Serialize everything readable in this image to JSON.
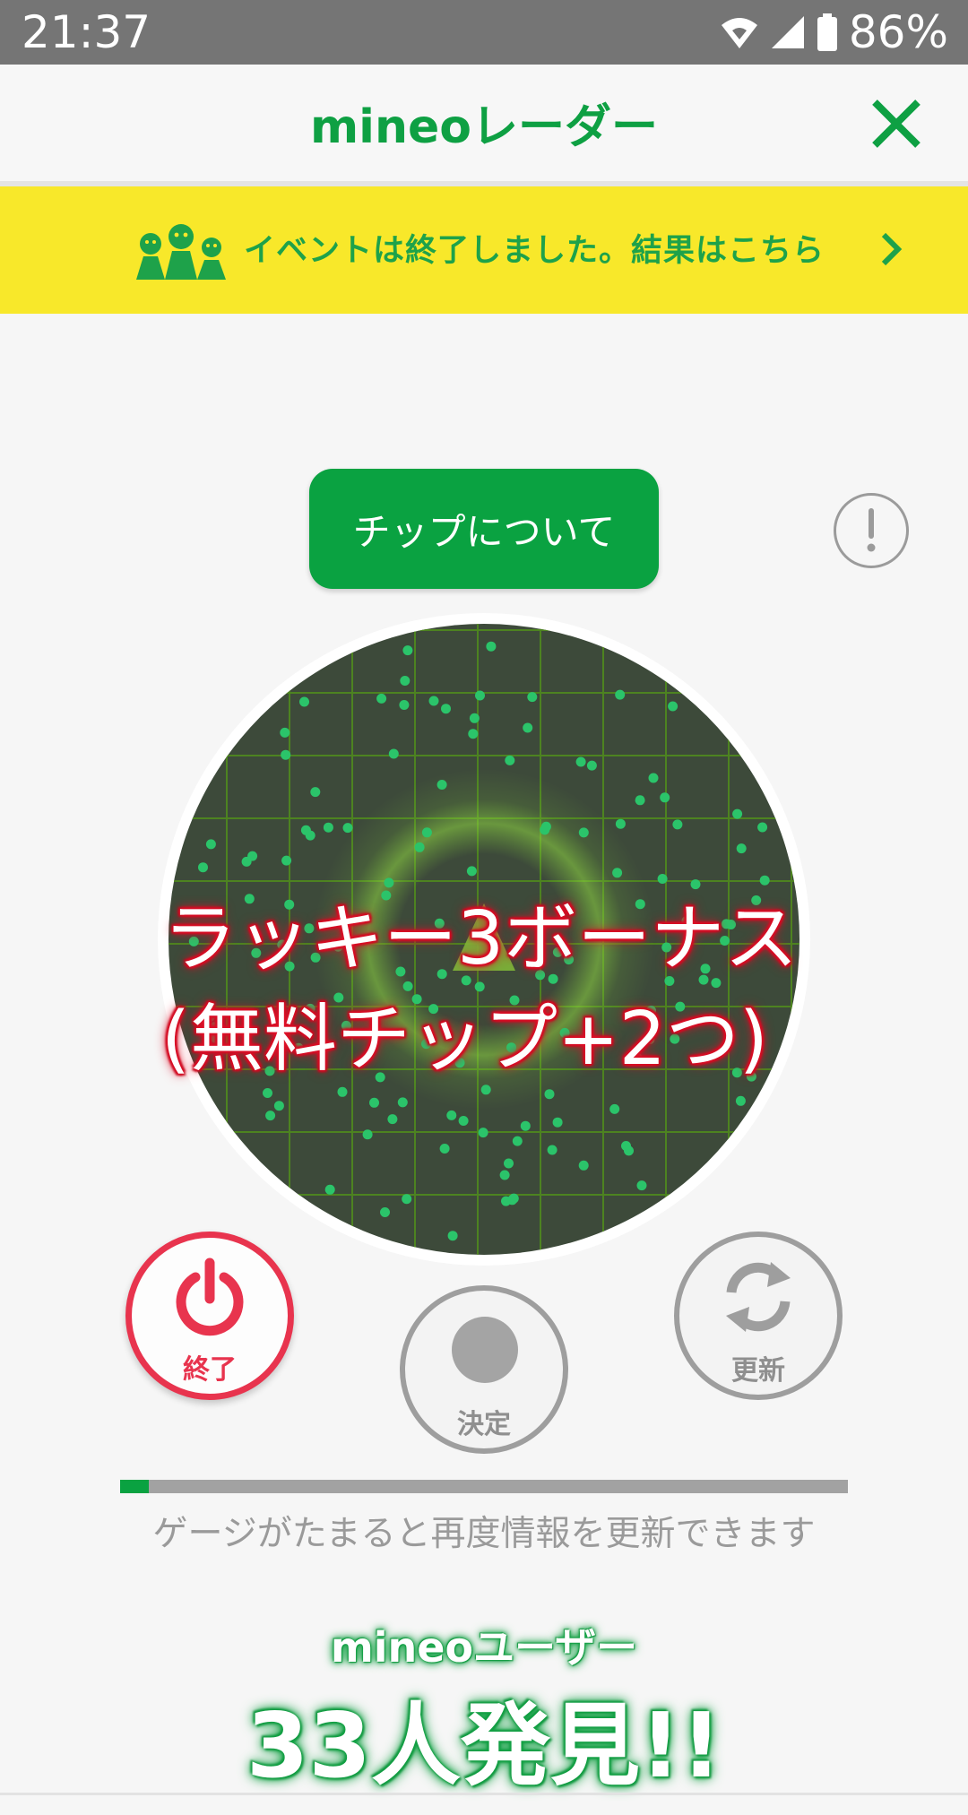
{
  "status_bar": {
    "time": "21:37",
    "battery": "86%"
  },
  "app_bar": {
    "title": "mineoレーダー",
    "close_icon": "close-icon"
  },
  "banner": {
    "text": "イベントは終了しました。結果はこちら",
    "icon": "mineo-users-icon"
  },
  "chip_button": {
    "label": "チップについて"
  },
  "radar": {
    "overlay_line1": "ラッキー3ボーナス",
    "overlay_line2": "(無料チップ+2つ)"
  },
  "controls": {
    "end_label": "終了",
    "decide_label": "決定",
    "refresh_label": "更新"
  },
  "gauge": {
    "fill_fraction": 0.04,
    "text": "ゲージがたまると再度情報を更新できます"
  },
  "found": {
    "label": "mineoユーザー",
    "count_text": "33人発見!!"
  },
  "colors": {
    "brand_green": "#0aa241",
    "banner_yellow": "#f8e82a",
    "end_red": "#e8344e"
  }
}
